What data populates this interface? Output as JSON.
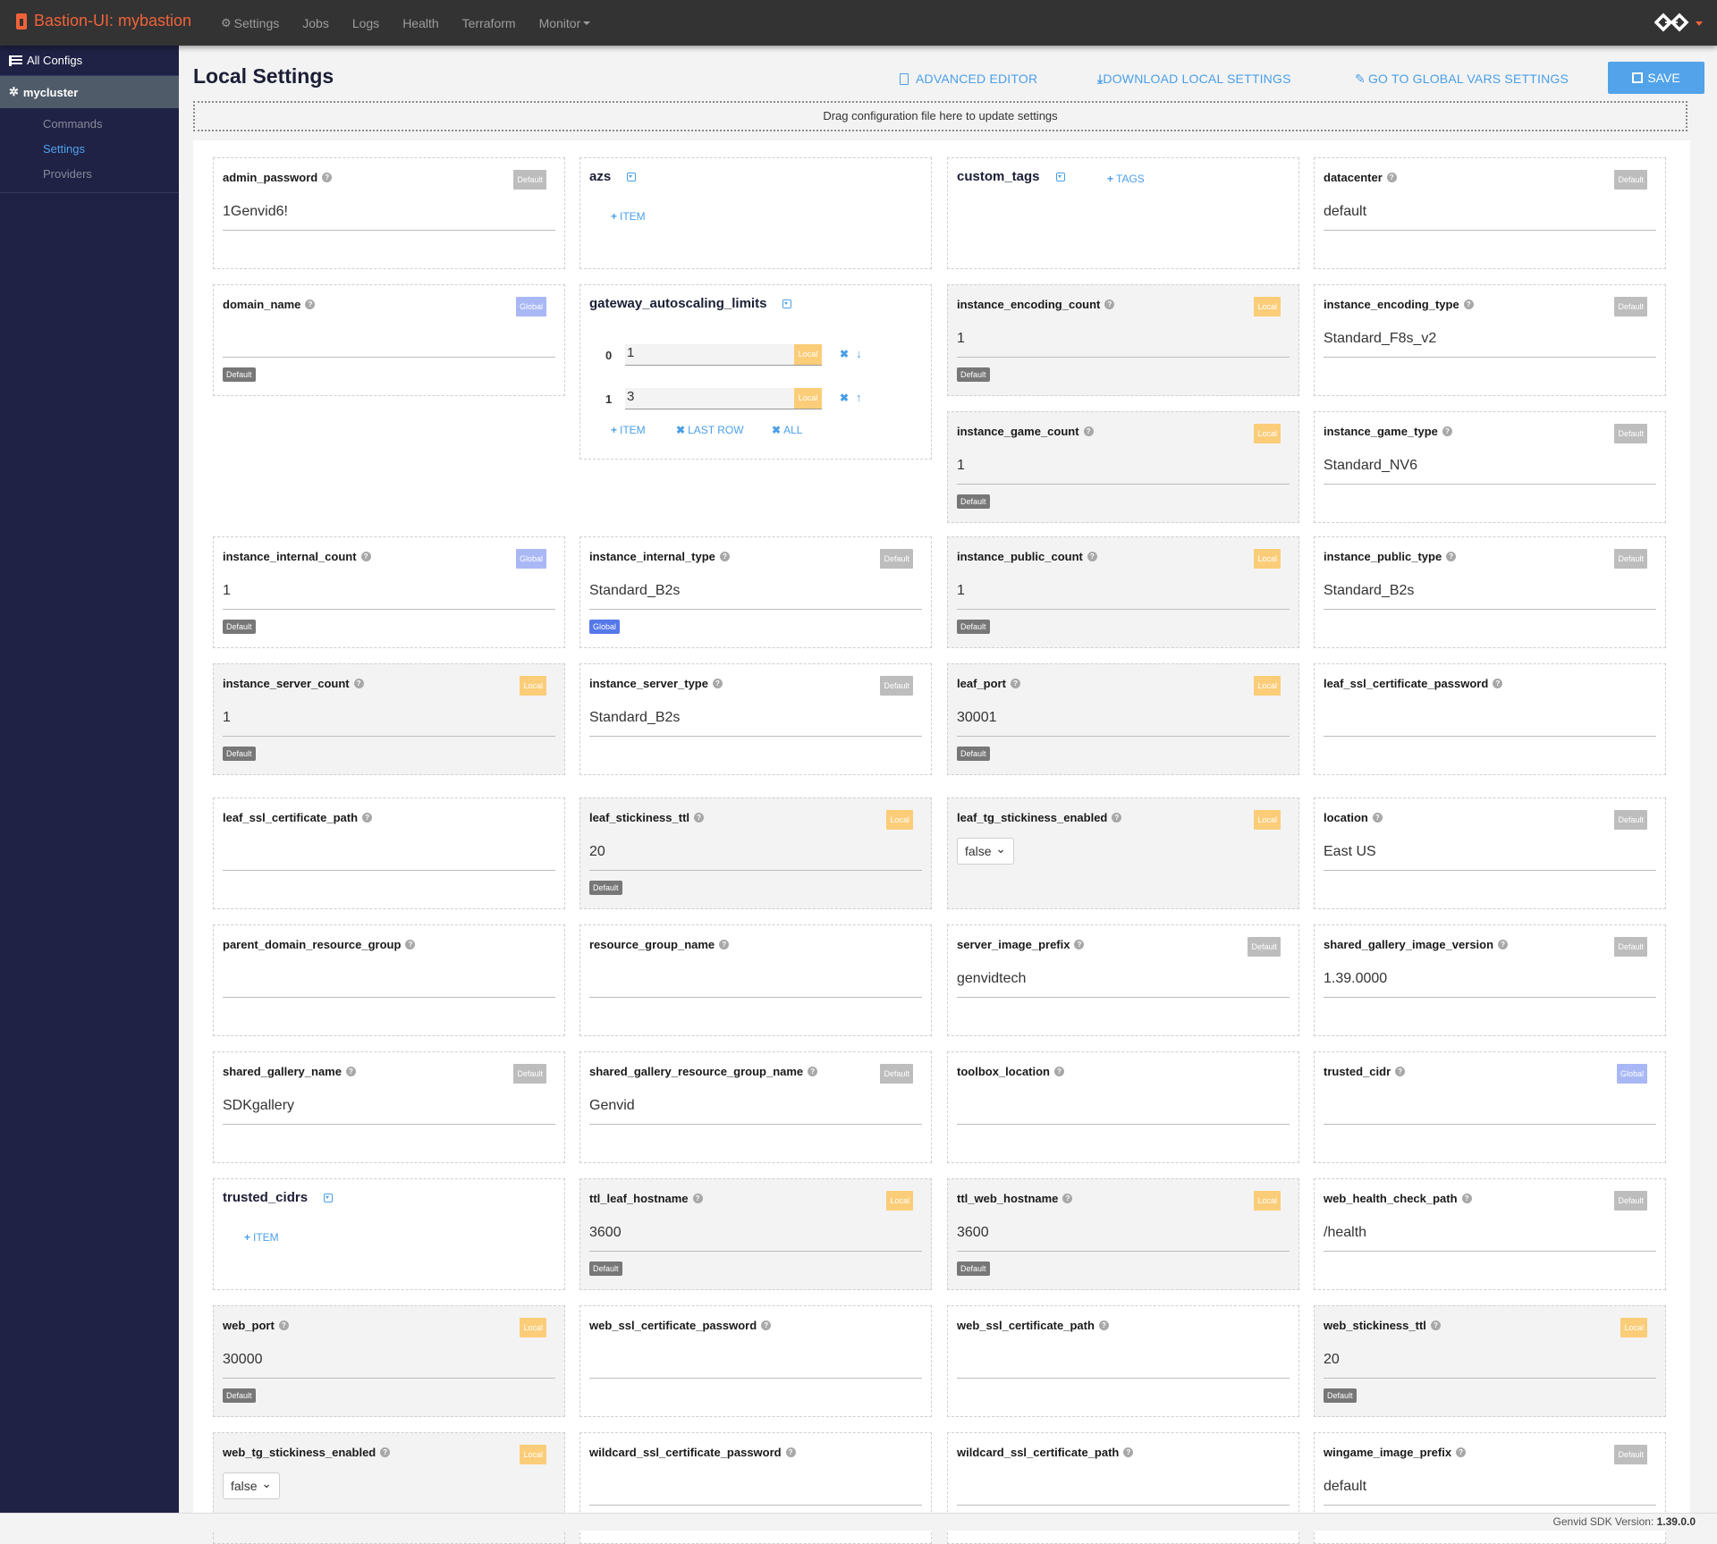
{
  "navbar": {
    "brand": "Bastion-UI: mybastion",
    "items": [
      {
        "label": "Settings",
        "icon": "gear-icon"
      },
      {
        "label": "Jobs"
      },
      {
        "label": "Logs"
      },
      {
        "label": "Health"
      },
      {
        "label": "Terraform"
      },
      {
        "label": "Monitor",
        "dropdown": true
      }
    ],
    "colors": {
      "brand": "#f0623a",
      "bar": "#333333"
    }
  },
  "sidebar": {
    "all_configs": "All Configs",
    "cluster": "mycluster",
    "links": [
      {
        "label": "Commands",
        "active": false
      },
      {
        "label": "Settings",
        "active": true
      },
      {
        "label": "Providers",
        "active": false
      }
    ]
  },
  "page": {
    "title": "Local Settings",
    "actions": {
      "advanced_editor": "ADVANCED EDITOR",
      "download": "DOWNLOAD LOCAL SETTINGS",
      "global_vars": "GO TO GLOBAL VARS SETTINGS",
      "save": "SAVE"
    },
    "drop_zone": "Drag configuration file here to update settings"
  },
  "common": {
    "item_btn": "ITEM",
    "tags_btn": "TAGS",
    "last_row_btn": "LAST ROW",
    "all_btn": "ALL",
    "badge_default": "Default",
    "badge_local": "Local",
    "badge_global": "Global"
  },
  "settings": [
    {
      "name": "admin_password",
      "value": "1Genvid6!",
      "badge": "Default"
    },
    {
      "name": "azs",
      "type": "list"
    },
    {
      "name": "custom_tags",
      "type": "tags"
    },
    {
      "name": "datacenter",
      "value": "default",
      "badge": "Default"
    },
    {
      "name": "domain_name",
      "value": "",
      "badge": "Global",
      "sub_badge": "Default"
    },
    {
      "name": "gateway_autoscaling_limits",
      "type": "list",
      "items": [
        {
          "index": "0",
          "value": "1",
          "badge": "Local"
        },
        {
          "index": "1",
          "value": "3",
          "badge": "Local"
        }
      ]
    },
    {
      "name": "instance_encoding_count",
      "value": "1",
      "badge": "Local",
      "sub_badge": "Default"
    },
    {
      "name": "instance_encoding_type",
      "value": "Standard_F8s_v2",
      "badge": "Default"
    },
    {
      "name": "instance_game_count",
      "value": "1",
      "badge": "Local",
      "sub_badge": "Default"
    },
    {
      "name": "instance_game_type",
      "value": "Standard_NV6",
      "badge": "Default"
    },
    {
      "name": "instance_internal_count",
      "value": "1",
      "badge": "Global",
      "sub_badge": "Default"
    },
    {
      "name": "instance_internal_type",
      "value": "Standard_B2s",
      "badge": "Default",
      "sub_badge": "Global"
    },
    {
      "name": "instance_public_count",
      "value": "1",
      "badge": "Local",
      "sub_badge": "Default"
    },
    {
      "name": "instance_public_type",
      "value": "Standard_B2s",
      "badge": "Default"
    },
    {
      "name": "instance_server_count",
      "value": "1",
      "badge": "Local",
      "sub_badge": "Default"
    },
    {
      "name": "instance_server_type",
      "value": "Standard_B2s",
      "badge": "Default"
    },
    {
      "name": "leaf_port",
      "value": "30001",
      "badge": "Local",
      "sub_badge": "Default"
    },
    {
      "name": "leaf_ssl_certificate_password",
      "value": ""
    },
    {
      "name": "leaf_ssl_certificate_path",
      "value": ""
    },
    {
      "name": "leaf_stickiness_ttl",
      "value": "20",
      "badge": "Local",
      "sub_badge": "Default"
    },
    {
      "name": "leaf_tg_stickiness_enabled",
      "type": "select",
      "value": "false",
      "badge": "Local"
    },
    {
      "name": "location",
      "value": "East US",
      "badge": "Default"
    },
    {
      "name": "parent_domain_resource_group",
      "value": ""
    },
    {
      "name": "resource_group_name",
      "value": ""
    },
    {
      "name": "server_image_prefix",
      "value": "genvidtech",
      "badge": "Default"
    },
    {
      "name": "shared_gallery_image_version",
      "value": "1.39.0000",
      "badge": "Default"
    },
    {
      "name": "shared_gallery_name",
      "value": "SDKgallery",
      "badge": "Default"
    },
    {
      "name": "shared_gallery_resource_group_name",
      "value": "Genvid",
      "badge": "Default"
    },
    {
      "name": "toolbox_location",
      "value": ""
    },
    {
      "name": "trusted_cidr",
      "value": "",
      "badge": "Global"
    },
    {
      "name": "trusted_cidrs",
      "type": "list"
    },
    {
      "name": "ttl_leaf_hostname",
      "value": "3600",
      "badge": "Local",
      "sub_badge": "Default"
    },
    {
      "name": "ttl_web_hostname",
      "value": "3600",
      "badge": "Local",
      "sub_badge": "Default"
    },
    {
      "name": "web_health_check_path",
      "value": "/health",
      "badge": "Default"
    },
    {
      "name": "web_port",
      "value": "30000",
      "badge": "Local",
      "sub_badge": "Default"
    },
    {
      "name": "web_ssl_certificate_password",
      "value": ""
    },
    {
      "name": "web_ssl_certificate_path",
      "value": ""
    },
    {
      "name": "web_stickiness_ttl",
      "value": "20",
      "badge": "Local",
      "sub_badge": "Default"
    },
    {
      "name": "web_tg_stickiness_enabled",
      "type": "select",
      "value": "false",
      "badge": "Local"
    },
    {
      "name": "wildcard_ssl_certificate_password",
      "value": ""
    },
    {
      "name": "wildcard_ssl_certificate_path",
      "value": ""
    },
    {
      "name": "wingame_image_prefix",
      "value": "default",
      "badge": "Default"
    }
  ],
  "footer": {
    "label": "Genvid SDK Version:",
    "version": "1.39.0.0"
  }
}
